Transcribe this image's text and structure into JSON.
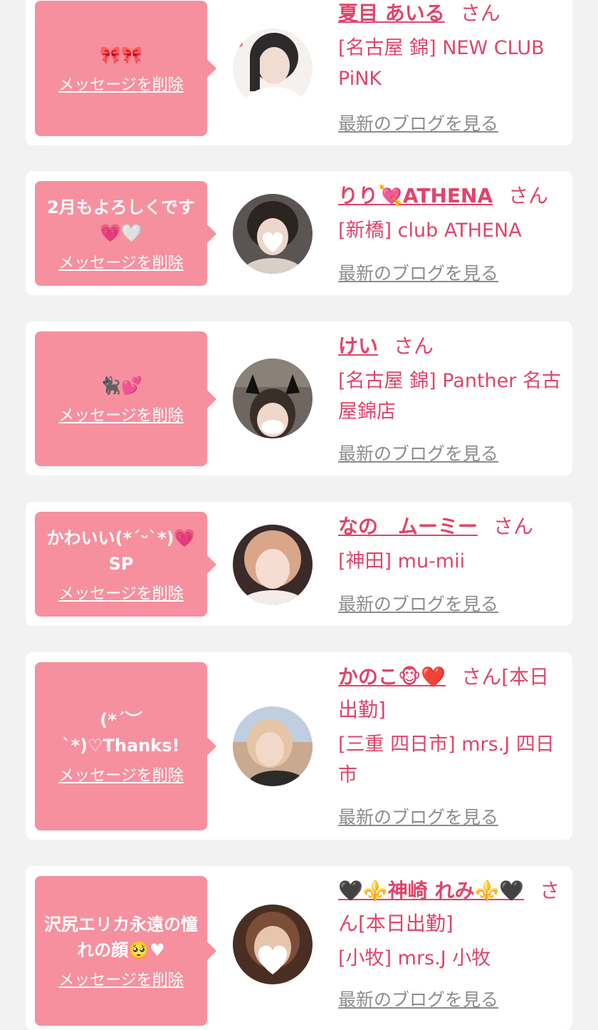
{
  "delete_label": "メッセージを削除",
  "blog_label": "最新のブログを見る",
  "cards": [
    {
      "message": "🎀🎀",
      "name": "夏目 あいる",
      "san": "さん",
      "shop": "[名古屋 錦] NEW CLUB PiNK"
    },
    {
      "message": "2月もよろしくです💗🤍",
      "name": "りり💘ATHENA",
      "san": "さん",
      "shop": "[新橋] club ATHENA"
    },
    {
      "message": "🐈‍⬛💕",
      "name": "けい",
      "san": "さん",
      "shop": "[名古屋 錦] Panther 名古屋錦店"
    },
    {
      "message": "かわいい(*´ᵕ`*)💗SP",
      "name": "なの　ムーミー",
      "san": "さん",
      "shop": "[神田] mu-mii"
    },
    {
      "message": "(*´︶`*)♡Thanks!",
      "name": "かのこ🐵❤️",
      "san": "さん[本日出勤]",
      "shop": "[三重 四日市] mrs.J 四日市"
    },
    {
      "message": "沢尻エリカ永遠の憧れの顔🥺♥",
      "name": "🖤⚜️神崎 れみ⚜️🖤",
      "san": "さん[本日出勤]",
      "shop": "[小牧] mrs.J 小牧"
    }
  ]
}
